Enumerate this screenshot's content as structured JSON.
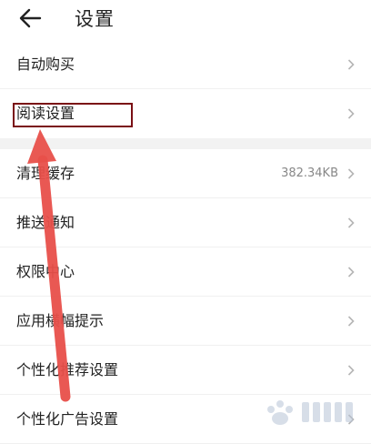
{
  "header": {
    "title": "设置",
    "back_icon": "arrow-left-icon"
  },
  "settings_top": [
    {
      "label": "自动购买"
    },
    {
      "label": "阅读设置"
    }
  ],
  "settings_bottom": [
    {
      "label": "清理缓存",
      "value": "382.34KB"
    },
    {
      "label": "推送通知"
    },
    {
      "label": "权限中心"
    },
    {
      "label": "应用横幅提示"
    },
    {
      "label": "个性化推荐设置"
    },
    {
      "label": "个性化广告设置"
    }
  ],
  "annotation": {
    "box_color": "#7a0f14",
    "arrow_color": "#e8504a"
  },
  "colors": {
    "separator": "#f2f2f2",
    "text": "#222222",
    "chevron": "#b5b5b5"
  }
}
